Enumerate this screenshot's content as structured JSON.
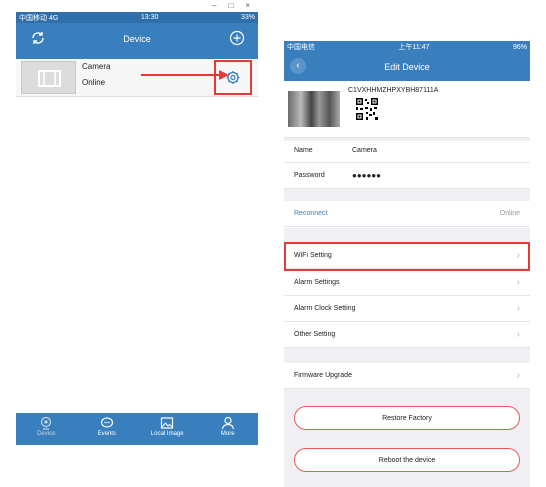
{
  "left_screen": {
    "window_controls": [
      "–",
      "□",
      "×"
    ],
    "status": {
      "carrier": "中国移动 4G",
      "time": "13:30",
      "battery": "33%"
    },
    "header_title": "Device",
    "device": {
      "name": "Camera",
      "status": "Online"
    },
    "tabs": [
      {
        "label": "Device",
        "icon": "camera-icon"
      },
      {
        "label": "Events",
        "icon": "chat-icon"
      },
      {
        "label": "Local Image",
        "icon": "image-icon"
      },
      {
        "label": "More",
        "icon": "person-icon"
      }
    ]
  },
  "right_screen": {
    "status": {
      "carrier": "中国电信",
      "time": "上午11:47",
      "battery": "96%"
    },
    "header_title": "Edit Device",
    "uid": "C1VXHHMZHPXYBH87111A",
    "name_label": "Name",
    "name_value": "Camera",
    "password_label": "Password",
    "password_value": "●●●●●●",
    "reconnect_label": "Reconnect",
    "reconnect_status": "Online",
    "settings": [
      "WiFi Setting",
      "Alarm Settings",
      "Alarm Clock Setting",
      "Other Setting"
    ],
    "firmware_label": "Firmware Upgrade",
    "restore_label": "Restore Factory",
    "reboot_label": "Reboot the device"
  },
  "colors": {
    "header_blue": "#3a7fbd",
    "highlight_red": "#e23c35"
  }
}
